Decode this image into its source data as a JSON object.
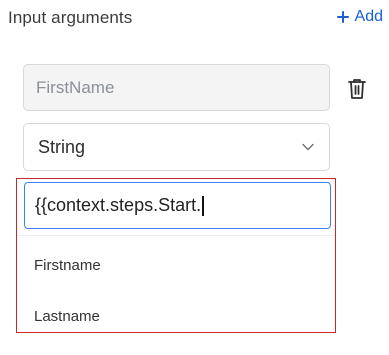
{
  "header": {
    "title": "Input arguments",
    "add_label": "Add"
  },
  "argument": {
    "name": "FirstName",
    "type": "String"
  },
  "value_input": {
    "text": "{{context.steps.Start."
  },
  "dropdown": {
    "options": [
      {
        "label": "Firstname"
      },
      {
        "label": "Lastname"
      }
    ]
  },
  "colors": {
    "accent": "#1a5fd6",
    "focus_border": "#3b82f6",
    "highlight_box": "#c8282c"
  }
}
